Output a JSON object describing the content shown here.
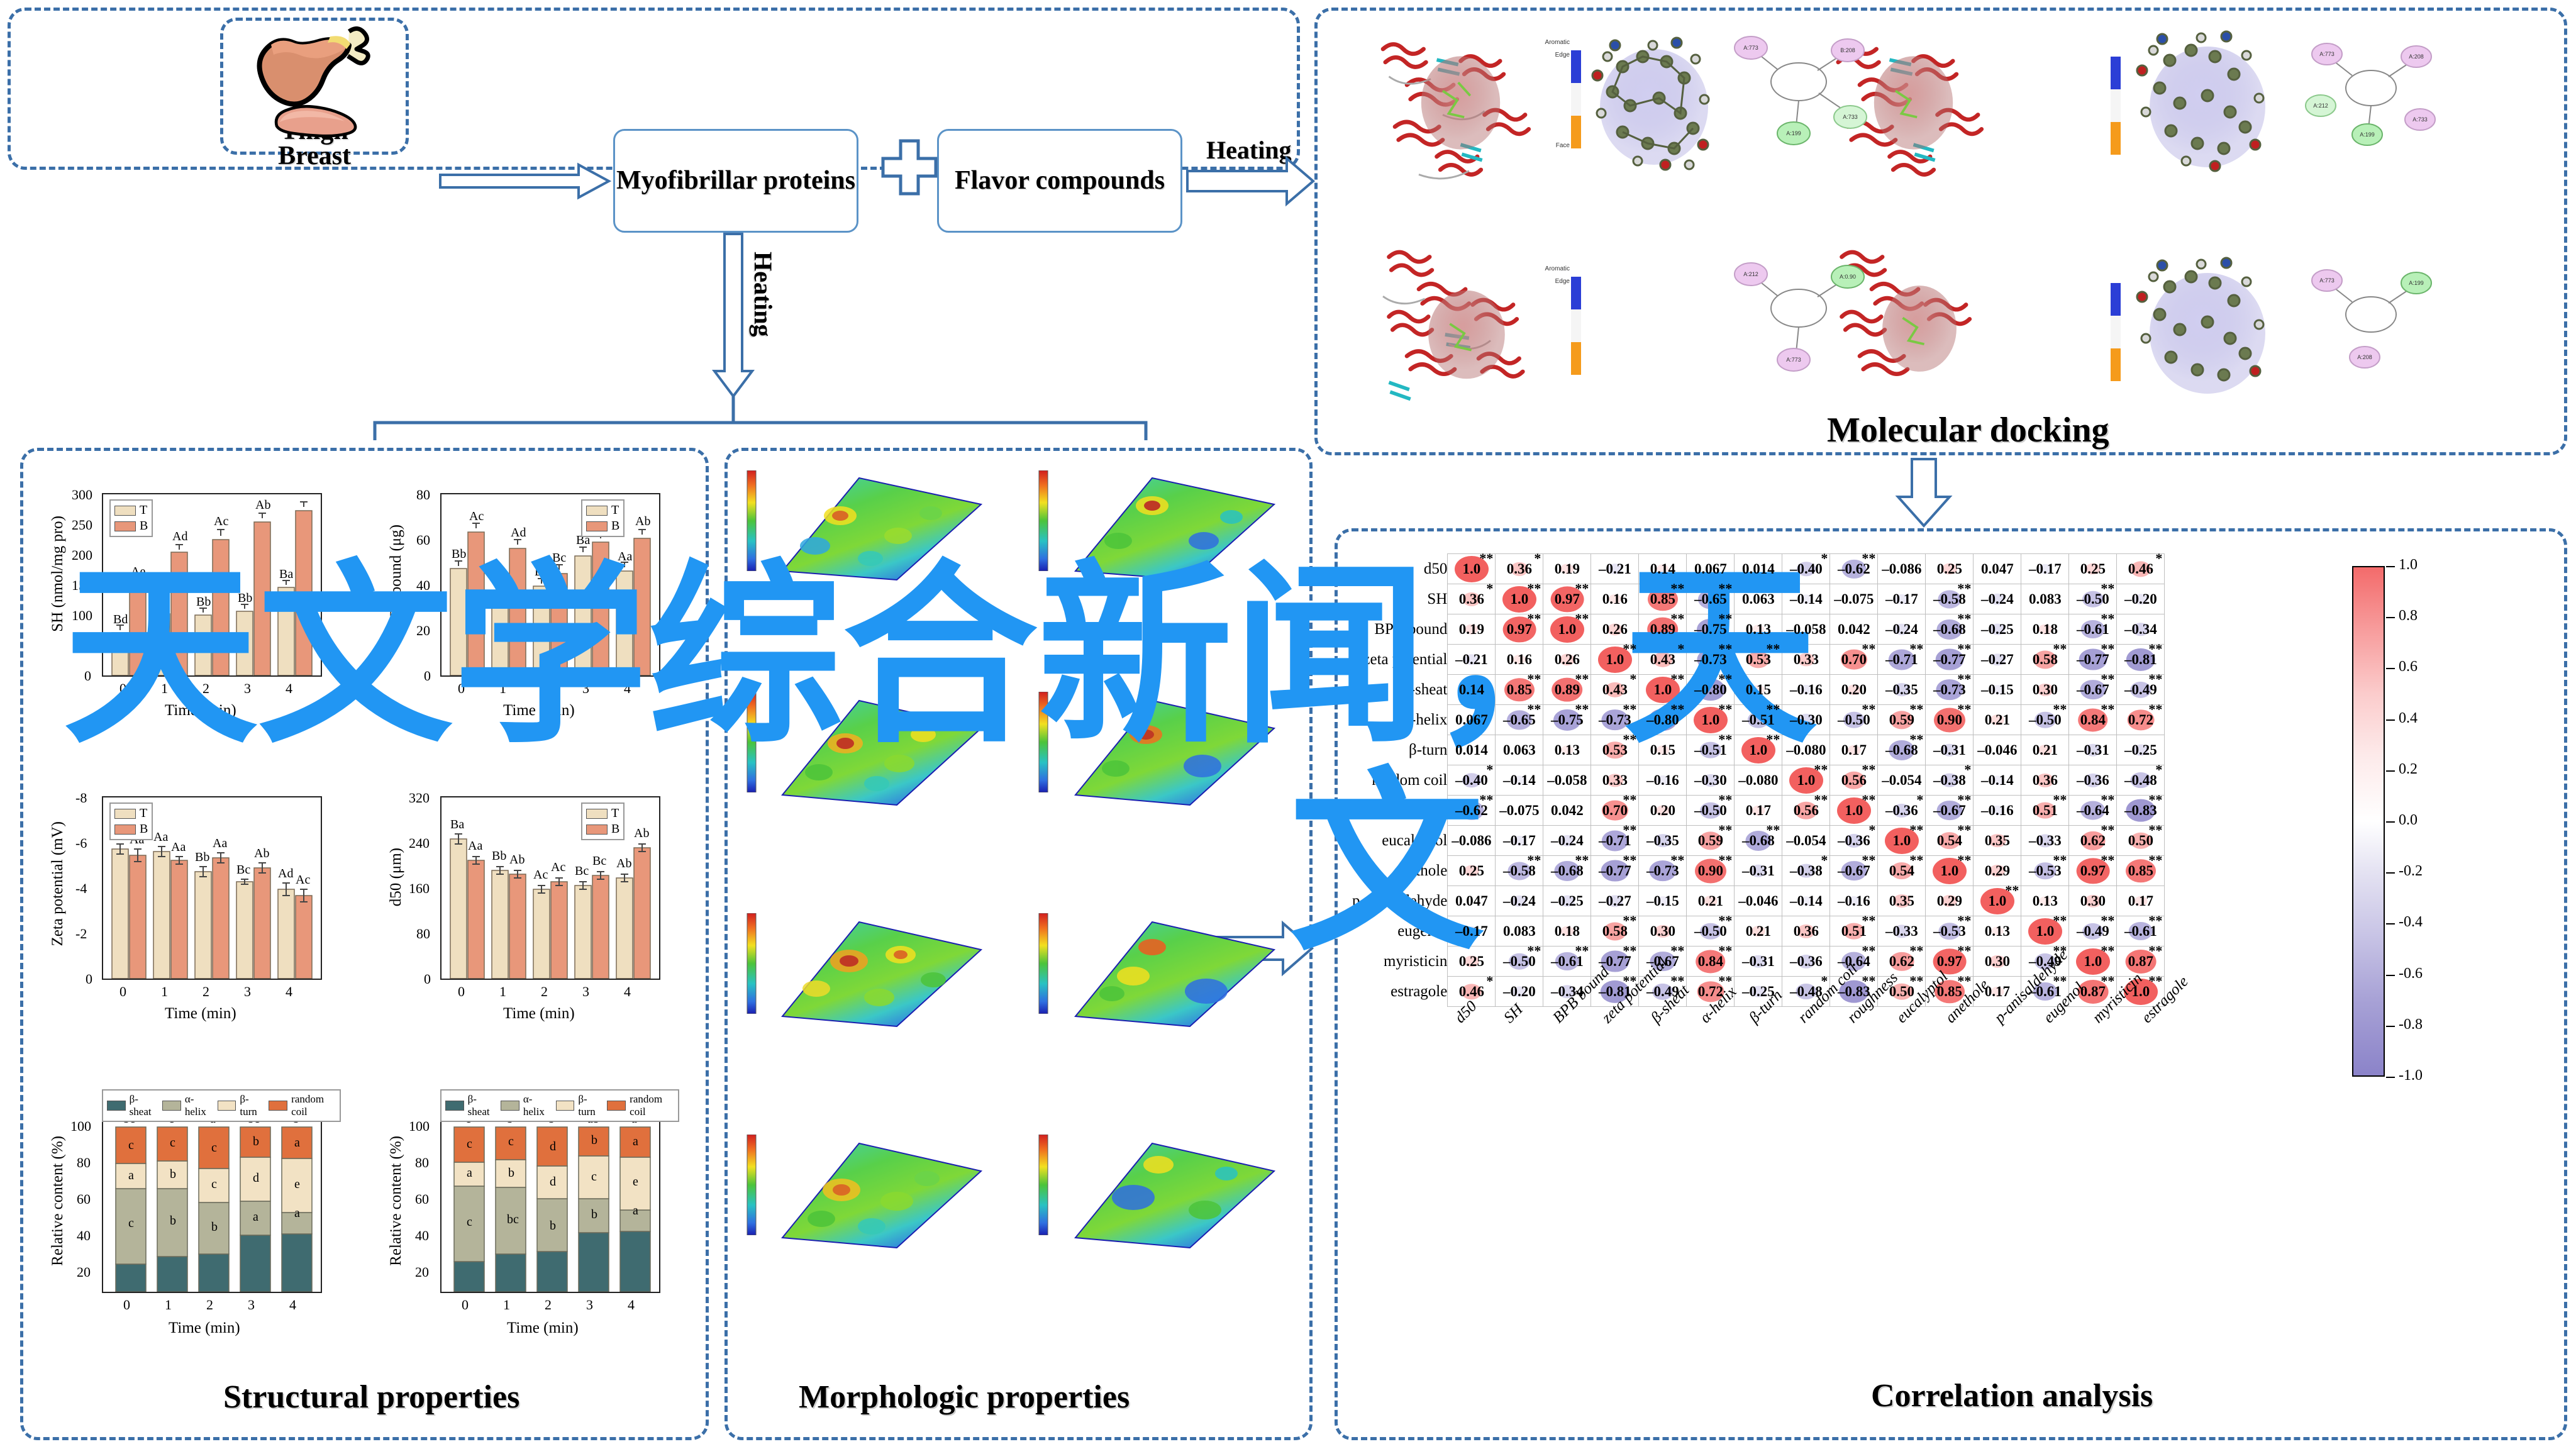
{
  "flow": {
    "samples": [
      {
        "label": "Thigh",
        "icon": "chicken-thigh-icon"
      },
      {
        "label": "Breast",
        "icon": "chicken-breast-icon"
      }
    ],
    "boxes": [
      {
        "id": "myofibrillar",
        "label": "Myofibrillar proteins"
      },
      {
        "id": "flavor",
        "label": "Flavor compounds"
      }
    ],
    "plus_symbol": "+",
    "arrow_labels": {
      "heating_right": "Heating",
      "heating_down": "Heating"
    }
  },
  "panels": {
    "molecular_docking": {
      "title": "Molecular docking"
    },
    "structural": {
      "title": "Structural properties"
    },
    "morphologic": {
      "title": "Morphologic properties"
    },
    "correlation": {
      "title": "Correlation analysis"
    }
  },
  "watermark": {
    "line1": "天文学综合新闻，天",
    "line2": "文"
  },
  "charts": {
    "sh": {
      "ylabel": "SH (nmol/mg pro)",
      "xlabel": "Time (min)",
      "yticks": [
        "300",
        "250",
        "200",
        "150",
        "100",
        "50",
        "0"
      ],
      "xticks": [
        "0",
        "1",
        "2",
        "3",
        "4"
      ],
      "legend": [
        "T",
        "B"
      ],
      "labels_T": [
        "Bd",
        "Bc",
        "Bb",
        "Bb",
        "Ba"
      ],
      "labels_B": [
        "Ae",
        "Ad",
        "Ac",
        "Ab",
        "Aa"
      ]
    },
    "bpb": {
      "ylabel": "BPB bound (μg)",
      "xlabel": "Time (min)",
      "yticks": [
        "80",
        "60",
        "40",
        "20",
        "0"
      ],
      "xticks": [
        "0",
        "1",
        "2",
        "3",
        "4"
      ],
      "legend": [
        "T",
        "B"
      ],
      "labels_T": [
        "Bb",
        "Bd",
        "Bc",
        "Ba",
        "Aa"
      ],
      "labels_B": [
        "Ac",
        "Ad",
        "Bc",
        "Ab",
        "Ab"
      ]
    },
    "zeta": {
      "ylabel": "Zeta potential (mV)",
      "xlabel": "Time (min)",
      "yticks": [
        "-8",
        "-6",
        "-4",
        "-2",
        "0"
      ],
      "xticks": [
        "0",
        "1",
        "2",
        "3",
        "4"
      ],
      "legend": [
        "T",
        "B"
      ],
      "labels_T": [
        "Aa",
        "Aa",
        "Bb",
        "Bc",
        "Ad"
      ],
      "labels_B": [
        "Aa",
        "Aa",
        "Aa",
        "Ab",
        "Ac"
      ]
    },
    "d50": {
      "ylabel": "d50 (μm)",
      "xlabel": "Time (min)",
      "yticks": [
        "320",
        "240",
        "160",
        "80",
        "0"
      ],
      "xticks": [
        "0",
        "1",
        "2",
        "3",
        "4"
      ],
      "legend": [
        "T",
        "B"
      ],
      "labels_T": [
        "Ba",
        "Bb",
        "Ac",
        "Bc",
        "Ab"
      ],
      "labels_B": [
        "Aa",
        "Ab",
        "Ac",
        "Bc",
        "Ab"
      ]
    },
    "struct_T": {
      "ylabel": "Relative content (%)",
      "xlabel": "Time (min)",
      "yticks": [
        "100",
        "80",
        "60",
        "40",
        "20"
      ],
      "xticks": [
        "0",
        "1",
        "2",
        "3",
        "4"
      ],
      "legend": [
        "β-sheat",
        "α-helix",
        "β-turn",
        "random coil"
      ],
      "top_labels": [
        "bc",
        "c",
        "a",
        "bc",
        "b"
      ],
      "seg_labels": [
        [
          "c",
          "a",
          "c"
        ],
        [
          "b",
          "b",
          "c"
        ],
        [
          "b",
          "c",
          "c"
        ],
        [
          "a",
          "d",
          "b"
        ],
        [
          "a",
          "e",
          "a"
        ]
      ]
    },
    "struct_B": {
      "ylabel": "Relative content (%)",
      "xlabel": "Time (min)",
      "yticks": [
        "100",
        "80",
        "60",
        "40",
        "20"
      ],
      "xticks": [
        "0",
        "1",
        "2",
        "3",
        "4"
      ],
      "legend": [
        "β-sheat",
        "α-helix",
        "β-turn",
        "random coil"
      ],
      "top_labels": [
        "c",
        "b",
        "b",
        "ab",
        "a"
      ],
      "seg_labels": [
        [
          "c",
          "a",
          "c"
        ],
        [
          "bc",
          "b",
          "c"
        ],
        [
          "b",
          "d",
          "d"
        ],
        [
          "b",
          "c",
          "b"
        ],
        [
          "a",
          "e",
          "a"
        ]
      ]
    }
  },
  "chart_data": {
    "type": "heatmap",
    "title": "Correlation analysis",
    "legend_position": "right",
    "colorbar": {
      "ticks": [
        "1.0",
        "0.8",
        "0.6",
        "0.4",
        "0.2",
        "0.0",
        "-0.2",
        "-0.4",
        "-0.6",
        "-0.8",
        "-1.0"
      ],
      "min": -1.0,
      "max": 1.0,
      "positive_color": "#f2605f",
      "negative_color": "#8b83c9"
    },
    "significance_note": {
      "one_star": "*",
      "two_stars": "**"
    },
    "categories": [
      "d50",
      "SH",
      "BPB bound",
      "zeta potential",
      "β-sheat",
      "α-helix",
      "β-turn",
      "random coil",
      "roughness",
      "eucalyptol",
      "anethole",
      "p-anisaldehyde",
      "eugenol",
      "myristicin",
      "estragole"
    ],
    "rows": [
      "d50",
      "SH",
      "BPB bound",
      "zeta potential",
      "β-sheat",
      "α-helix",
      "β-turn",
      "random coil",
      "roughness",
      "eucalyptol",
      "anethole",
      "p-anisaldehyde",
      "eugenol",
      "myristicin",
      "estragole"
    ],
    "values": [
      [
        1.0,
        0.36,
        0.19,
        -0.21,
        0.14,
        0.067,
        0.014,
        -0.4,
        -0.62,
        -0.086,
        0.25,
        0.047,
        -0.17,
        0.25,
        0.46
      ],
      [
        0.36,
        1.0,
        0.97,
        0.16,
        0.85,
        -0.65,
        0.063,
        -0.14,
        -0.075,
        -0.17,
        -0.58,
        -0.24,
        0.083,
        -0.5,
        -0.2
      ],
      [
        0.19,
        0.97,
        1.0,
        0.26,
        0.89,
        -0.75,
        0.13,
        -0.058,
        0.042,
        -0.24,
        -0.68,
        -0.25,
        0.18,
        -0.61,
        -0.34
      ],
      [
        -0.21,
        0.16,
        0.26,
        1.0,
        0.43,
        -0.73,
        0.53,
        0.33,
        0.7,
        -0.71,
        -0.77,
        -0.27,
        0.58,
        -0.77,
        -0.81
      ],
      [
        0.14,
        0.85,
        0.89,
        0.43,
        1.0,
        -0.8,
        0.15,
        -0.16,
        0.2,
        -0.35,
        -0.73,
        -0.15,
        0.3,
        -0.67,
        -0.49
      ],
      [
        0.067,
        -0.65,
        -0.75,
        -0.73,
        -0.8,
        1.0,
        -0.51,
        -0.3,
        -0.5,
        0.59,
        0.9,
        0.21,
        -0.5,
        0.84,
        0.72
      ],
      [
        0.014,
        0.063,
        0.13,
        0.53,
        0.15,
        -0.51,
        1.0,
        -0.08,
        0.17,
        -0.68,
        -0.31,
        -0.046,
        0.21,
        -0.31,
        -0.25
      ],
      [
        -0.4,
        -0.14,
        -0.058,
        0.33,
        -0.16,
        -0.3,
        -0.08,
        1.0,
        0.56,
        -0.054,
        -0.38,
        -0.14,
        0.36,
        -0.36,
        -0.48
      ],
      [
        -0.62,
        -0.075,
        0.042,
        0.7,
        0.2,
        -0.5,
        0.17,
        0.56,
        1.0,
        -0.36,
        -0.67,
        -0.16,
        0.51,
        -0.64,
        -0.83
      ],
      [
        -0.086,
        -0.17,
        -0.24,
        -0.71,
        -0.35,
        0.59,
        -0.68,
        -0.054,
        -0.36,
        1.0,
        0.54,
        0.35,
        -0.33,
        0.62,
        0.5
      ],
      [
        0.25,
        -0.58,
        -0.68,
        -0.77,
        -0.73,
        0.9,
        -0.31,
        -0.38,
        -0.67,
        0.54,
        1.0,
        0.29,
        -0.53,
        0.97,
        0.85
      ],
      [
        0.047,
        -0.24,
        -0.25,
        -0.27,
        -0.15,
        0.21,
        -0.046,
        -0.14,
        -0.16,
        0.35,
        0.29,
        1.0,
        0.13,
        0.3,
        0.17
      ],
      [
        -0.17,
        0.083,
        0.18,
        0.58,
        0.3,
        -0.5,
        0.21,
        0.36,
        0.51,
        -0.33,
        -0.53,
        0.13,
        1.0,
        -0.49,
        -0.61
      ],
      [
        0.25,
        -0.5,
        -0.61,
        -0.77,
        -0.67,
        0.84,
        -0.31,
        -0.36,
        -0.64,
        0.62,
        0.97,
        0.3,
        -0.49,
        1.0,
        0.87
      ],
      [
        0.46,
        -0.2,
        -0.34,
        -0.81,
        -0.49,
        0.72,
        -0.25,
        -0.48,
        -0.83,
        0.5,
        0.85,
        0.17,
        -0.61,
        0.87,
        1.0
      ]
    ],
    "stars": [
      [
        "**",
        "*",
        "",
        "",
        "",
        "",
        "",
        "*",
        "**",
        "",
        "",
        "",
        "",
        "",
        "*"
      ],
      [
        "*",
        "**",
        "**",
        "",
        "**",
        "**",
        "",
        "",
        "",
        "",
        "**",
        "",
        "",
        "**",
        ""
      ],
      [
        "",
        "**",
        "**",
        "",
        "**",
        "**",
        "",
        "",
        "",
        "",
        "**",
        "",
        "",
        "**",
        ""
      ],
      [
        "",
        "",
        "",
        "**",
        "*",
        "**",
        "**",
        "",
        "**",
        "**",
        "**",
        "",
        "**",
        "**",
        "**"
      ],
      [
        "",
        "**",
        "**",
        "*",
        "**",
        "**",
        "",
        "",
        "",
        "",
        "**",
        "",
        "",
        "**",
        "**"
      ],
      [
        "",
        "**",
        "**",
        "**",
        "**",
        "**",
        "**",
        "",
        "**",
        "**",
        "**",
        "",
        "**",
        "**",
        "**"
      ],
      [
        "",
        "",
        "",
        "**",
        "",
        "**",
        "**",
        "",
        "",
        "**",
        "",
        "",
        "",
        "",
        ""
      ],
      [
        "*",
        "",
        "",
        "",
        "",
        "",
        "",
        "**",
        "**",
        "",
        "*",
        "",
        "",
        "",
        "*"
      ],
      [
        "**",
        "",
        "",
        "**",
        "",
        "**",
        "",
        "**",
        "**",
        "*",
        "**",
        "",
        "**",
        "**",
        "**"
      ],
      [
        "",
        "",
        "",
        "**",
        "",
        "**",
        "**",
        "",
        "*",
        "**",
        "**",
        "",
        "",
        "**",
        "**"
      ],
      [
        "",
        "**",
        "**",
        "**",
        "**",
        "**",
        "",
        "*",
        "**",
        "**",
        "**",
        "",
        "**",
        "**",
        "**"
      ],
      [
        "",
        "",
        "",
        "",
        "",
        "",
        "",
        "",
        "",
        "",
        "",
        "**",
        "",
        "",
        ""
      ],
      [
        "",
        "",
        "",
        "**",
        "",
        "**",
        "",
        "",
        "**",
        "",
        "**",
        "",
        "**",
        "**",
        "**"
      ],
      [
        "",
        "**",
        "**",
        "**",
        "**",
        "**",
        "",
        "",
        "**",
        "**",
        "**",
        "",
        "**",
        "**",
        "**"
      ],
      [
        "*",
        "",
        "",
        "**",
        "**",
        "**",
        "",
        "*",
        "**",
        "**",
        "**",
        "",
        "**",
        "**",
        "**"
      ]
    ]
  }
}
